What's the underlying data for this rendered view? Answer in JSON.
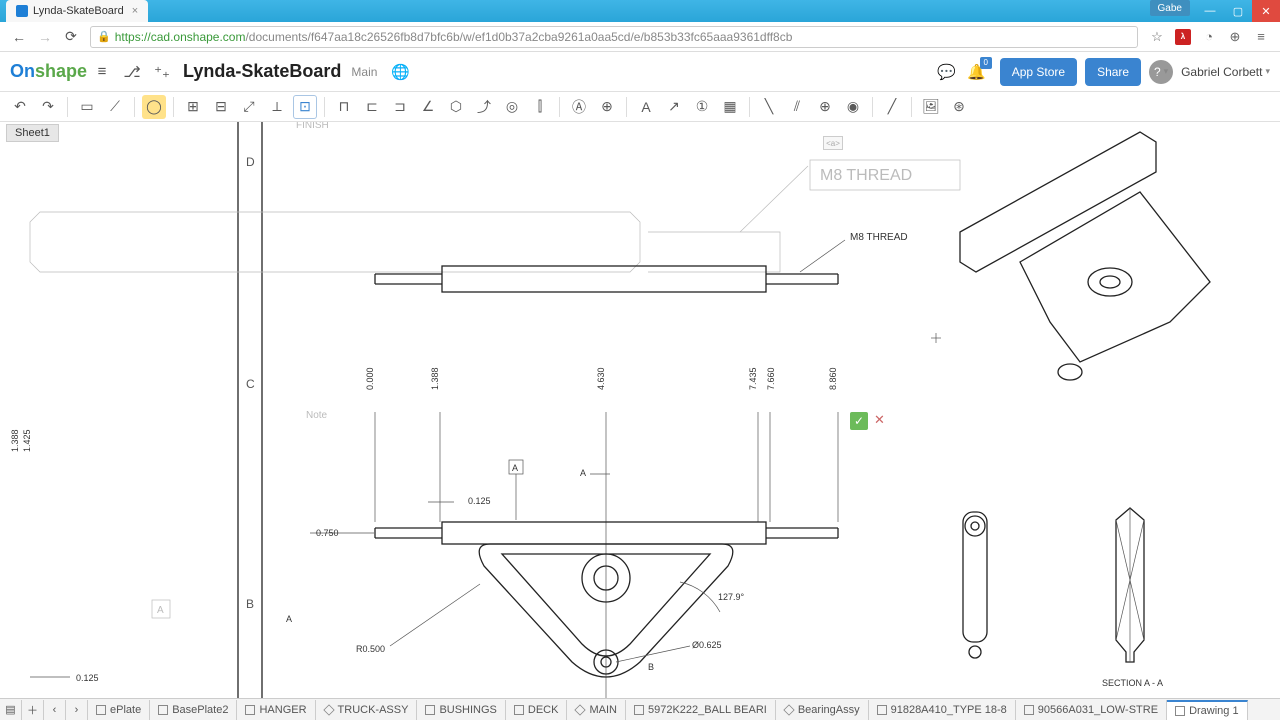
{
  "browser": {
    "tab_title": "Lynda-SkateBoard",
    "user_chip": "Gabe",
    "url_host": "cad.onshape.com",
    "url_path": "/documents/f647aa18c26526fb8d7bfc6b/w/ef1d0b37a2cba9261a0aa5cd/e/b853b33fc65aaa9361dff8cb",
    "url_scheme": "https://"
  },
  "header": {
    "logo_on": "On",
    "logo_shape": "shape",
    "doc_name": "Lynda-SkateBoard",
    "branch": "Main",
    "appstore": "App Store",
    "share": "Share",
    "notif_count": "0",
    "user": "Gabriel Corbett",
    "help": "?"
  },
  "sheet_tab": "Sheet1",
  "drawing": {
    "zones": {
      "D": "D",
      "C": "C",
      "B": "B"
    },
    "callout1": "M8 THREAD",
    "callout1_ghost": "M8 THREAD",
    "note_ghost": "Note",
    "finish_ghost": "FINISH",
    "datum_A": "A",
    "section_label": "SECTION A - A",
    "dims": {
      "d0000": "0.000",
      "d1388": "1.388",
      "d4630": "4.630",
      "d7435": "7.435",
      "d7660": "7.660",
      "d8860": "8.860",
      "d1388_left": "1.388",
      "d1425_left": "1.425",
      "h0125": "0.125",
      "h0750": "0.750",
      "h0125_bottom": "0.125",
      "ang": "127.9°",
      "radius": "R0.500",
      "dia": "Ø0.625",
      "datum_b": "B",
      "section_a1": "A",
      "section_a2": "A"
    }
  },
  "bottom_tabs": [
    {
      "label": "ePlate",
      "type": "part"
    },
    {
      "label": "BasePlate2",
      "type": "part"
    },
    {
      "label": "HANGER",
      "type": "part"
    },
    {
      "label": "TRUCK-ASSY",
      "type": "asm"
    },
    {
      "label": "BUSHINGS",
      "type": "part"
    },
    {
      "label": "DECK",
      "type": "part"
    },
    {
      "label": "MAIN",
      "type": "asm"
    },
    {
      "label": "5972K222_BALL BEARI",
      "type": "part"
    },
    {
      "label": "BearingAssy",
      "type": "asm"
    },
    {
      "label": "91828A410_TYPE 18-8",
      "type": "part"
    },
    {
      "label": "90566A031_LOW-STRE",
      "type": "part"
    },
    {
      "label": "Drawing 1",
      "type": "dwg"
    }
  ]
}
